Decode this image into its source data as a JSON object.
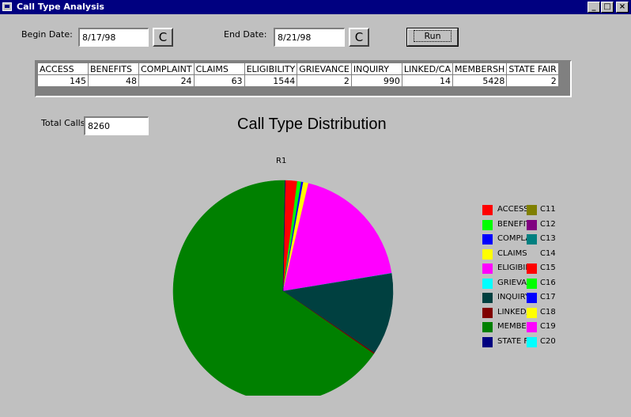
{
  "window": {
    "title": "Call Type Analysis",
    "controls": [
      "_",
      "□",
      "×"
    ]
  },
  "filters": {
    "begin_label": "Begin Date:",
    "begin_value": "8/17/98",
    "end_label": "End Date:",
    "end_value": "8/21/98",
    "calendar_button_label": "C",
    "run_label": "Run"
  },
  "grid": {
    "headers": [
      "ACCESS",
      "BENEFITS",
      "COMPLAINT",
      "CLAIMS",
      "ELIGIBILITY",
      "GRIEVANCE",
      "INQUIRY",
      "LINKED/CA",
      "MEMBERSH",
      "STATE FAIR"
    ],
    "values": [
      "145",
      "48",
      "24",
      "63",
      "1544",
      "2",
      "990",
      "14",
      "5428",
      "2"
    ]
  },
  "total": {
    "label": "Total Calls",
    "value": "8260"
  },
  "chart_data": {
    "type": "pie",
    "title": "Call Type Distribution",
    "row_label": "R1",
    "categories": [
      "ACCESS",
      "BENEFITS",
      "COMPLAINT",
      "CLAIMS",
      "ELIGIBILITY",
      "GRIEVANCE",
      "INQUIRY",
      "LINKED/CA",
      "MEMBERSHIP",
      "STATE FAIR"
    ],
    "values": [
      145,
      48,
      24,
      63,
      1544,
      2,
      990,
      14,
      5428,
      2
    ],
    "colors": [
      "#ff0000",
      "#00ff00",
      "#0000ff",
      "#ffff00",
      "#ff00ff",
      "#00ffff",
      "#004040",
      "#800000",
      "#008000",
      "#000080"
    ],
    "legend": [
      {
        "label": "ACCESS",
        "color": "#ff0000"
      },
      {
        "label": "BENEFITS",
        "color": "#00ff00"
      },
      {
        "label": "COMPLAINT",
        "color": "#0000ff"
      },
      {
        "label": "CLAIMS",
        "color": "#ffff00"
      },
      {
        "label": "ELIGIBILITY",
        "color": "#ff00ff"
      },
      {
        "label": "GRIEVANCE",
        "color": "#00ffff"
      },
      {
        "label": "INQUIRY",
        "color": "#004040"
      },
      {
        "label": "LINKED/CA",
        "color": "#800000"
      },
      {
        "label": "MEMBERSHIP",
        "color": "#008000"
      },
      {
        "label": "STATE FAIR",
        "color": "#000080"
      }
    ],
    "legend_extra": [
      {
        "label": "C11",
        "color": "#808000"
      },
      {
        "label": "C12",
        "color": "#800080"
      },
      {
        "label": "C13",
        "color": "#008080"
      },
      {
        "label": "C14",
        "color": "#c0c0c0"
      },
      {
        "label": "C15",
        "color": "#ff0000"
      },
      {
        "label": "C16",
        "color": "#00ff00"
      },
      {
        "label": "C17",
        "color": "#0000ff"
      },
      {
        "label": "C18",
        "color": "#ffff00"
      },
      {
        "label": "C19",
        "color": "#ff00ff"
      },
      {
        "label": "C20",
        "color": "#00ffff"
      }
    ],
    "legend_position": "right"
  }
}
